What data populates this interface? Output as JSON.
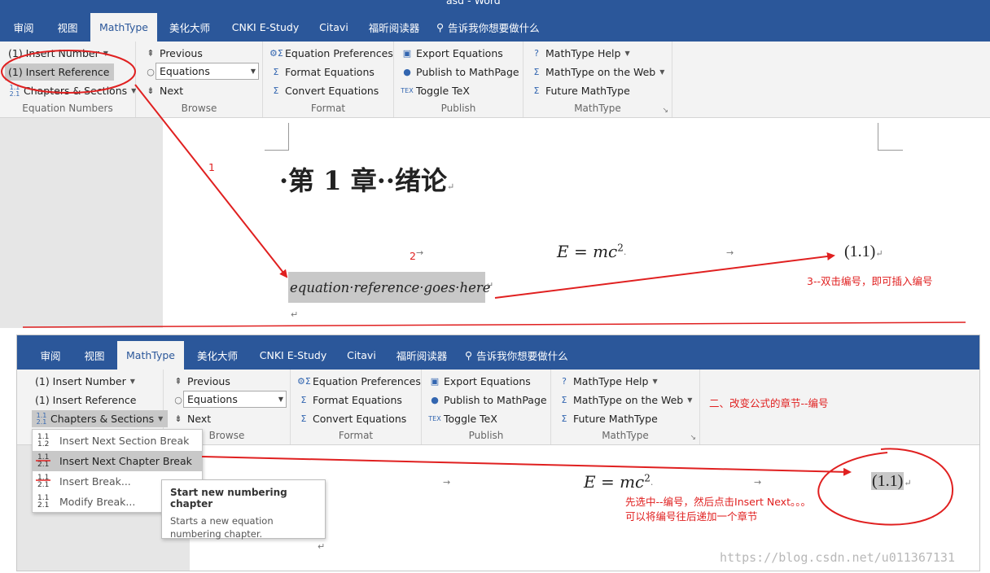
{
  "title_bar": {
    "text": "asd  -  Word"
  },
  "tabs": [
    "审阅",
    "视图",
    "MathType",
    "美化大师",
    "CNKI E-Study",
    "Citavi",
    "福昕阅读器"
  ],
  "tell_me": "告诉我你想要做什么",
  "ribbon": {
    "equation_numbers": {
      "insert_number": "(1) Insert Number",
      "insert_reference": "(1) Insert Reference",
      "chapters_sections": "Chapters & Sections",
      "group": "Equation Numbers"
    },
    "browse": {
      "previous": "Previous",
      "equations": "Equations",
      "next": "Next",
      "group": "Browse"
    },
    "format": {
      "prefs": "Equation Preferences",
      "format_eq": "Format Equations",
      "convert": "Convert Equations",
      "group": "Format"
    },
    "publish": {
      "export": "Export Equations",
      "publish_mathpage": "Publish to MathPage",
      "toggle_tex": "Toggle TeX",
      "group": "Publish"
    },
    "mathtype": {
      "help": "MathType Help",
      "web": "MathType on the Web",
      "future": "Future MathType",
      "group": "MathType"
    }
  },
  "doc1": {
    "heading": "·第 1 章··绪论",
    "equation": "E = mc",
    "exponent": "2",
    "eq_number": "(1.1)",
    "reference": "equation·reference·goes·here"
  },
  "annotations": {
    "a1": "1",
    "a2": "2",
    "a3": "3--双击编号，即可插入编号",
    "a_change": "二、改变公式的章节--编号",
    "a_select1": "先选中--编号，然后点击Insert Next。。。",
    "a_select2": "可以将编号往后递加一个章节"
  },
  "menu": {
    "items": [
      "Insert Next Section Break",
      "Insert Next Chapter Break",
      "Insert Break...",
      "Modify Break..."
    ]
  },
  "tooltip": {
    "title": "Start new numbering chapter",
    "body": "Starts a new equation numbering chapter."
  },
  "doc2": {
    "equation": "E = mc",
    "exponent": "2",
    "eq_number": "(1.1)"
  },
  "watermark": "https://blog.csdn.net/u011367131",
  "colors": {
    "ribbon_tab": "#2b579a",
    "annotation": "#e02020",
    "selection": "#c8c8c8"
  }
}
